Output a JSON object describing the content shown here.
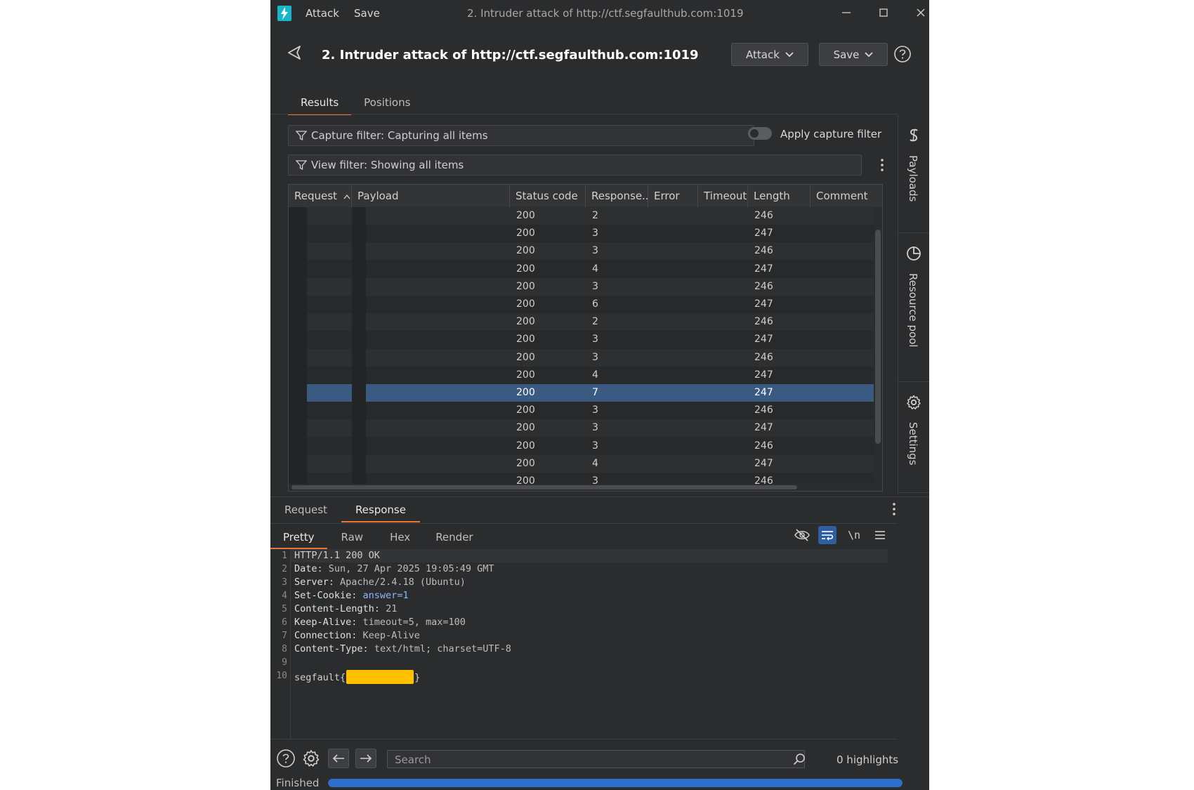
{
  "titlebar": {
    "menu": [
      "Attack",
      "Save"
    ],
    "title": "2. Intruder attack of http://ctf.segfaulthub.com:1019"
  },
  "header": {
    "title": "2. Intruder attack of http://ctf.segfaulthub.com:1019",
    "attack_label": "Attack",
    "save_label": "Save"
  },
  "tabs": [
    "Results",
    "Positions"
  ],
  "filters": {
    "capture": "Capture filter: Capturing all items",
    "view": "View filter: Showing all items",
    "apply_label": "Apply capture filter"
  },
  "table": {
    "columns": [
      "Request",
      "Payload",
      "Status code",
      "Response...",
      "Error",
      "Timeout",
      "Length",
      "Comment"
    ],
    "rows": [
      {
        "status": "200",
        "response": "2",
        "length": "246"
      },
      {
        "status": "200",
        "response": "3",
        "length": "247"
      },
      {
        "status": "200",
        "response": "3",
        "length": "246"
      },
      {
        "status": "200",
        "response": "4",
        "length": "247"
      },
      {
        "status": "200",
        "response": "3",
        "length": "246"
      },
      {
        "status": "200",
        "response": "6",
        "length": "247"
      },
      {
        "status": "200",
        "response": "2",
        "length": "246"
      },
      {
        "status": "200",
        "response": "3",
        "length": "247"
      },
      {
        "status": "200",
        "response": "3",
        "length": "246"
      },
      {
        "status": "200",
        "response": "4",
        "length": "247"
      },
      {
        "status": "200",
        "response": "7",
        "length": "247",
        "selected": true
      },
      {
        "status": "200",
        "response": "3",
        "length": "246"
      },
      {
        "status": "200",
        "response": "3",
        "length": "247"
      },
      {
        "status": "200",
        "response": "3",
        "length": "246"
      },
      {
        "status": "200",
        "response": "4",
        "length": "247"
      },
      {
        "status": "200",
        "response": "3",
        "length": "246"
      }
    ]
  },
  "side_panel": [
    "Payloads",
    "Resource pool",
    "Settings"
  ],
  "lower_tabs": [
    "Request",
    "Response"
  ],
  "sub_tabs": [
    "Pretty",
    "Raw",
    "Hex",
    "Render"
  ],
  "response": {
    "line_numbers": [
      "1",
      "2",
      "3",
      "4",
      "5",
      "6",
      "7",
      "8",
      "9",
      "10"
    ],
    "status_line": "HTTP/1.1 200 OK",
    "headers": [
      {
        "k": "Date",
        "v": "Sun, 27 Apr 2025 19:05:49 GMT"
      },
      {
        "k": "Server",
        "v": "Apache/2.4.18 (Ubuntu)"
      },
      {
        "k": "Set-Cookie",
        "v": "answer=1"
      },
      {
        "k": "Content-Length",
        "v": "21"
      },
      {
        "k": "Keep-Alive",
        "v": "timeout=5, max=100"
      },
      {
        "k": "Connection",
        "v": "Keep-Alive"
      },
      {
        "k": "Content-Type",
        "v": "text/html; charset=UTF-8"
      }
    ],
    "body_prefix": "segfault{",
    "body_suffix": "}"
  },
  "footer": {
    "search_placeholder": "Search",
    "highlights": "0 highlights",
    "status": "Finished",
    "progress": 1.0
  },
  "colors": {
    "accent": "#e8743b",
    "selection": "#3a5a82",
    "redaction": "#ffc000",
    "progress": "#2f6fcc"
  }
}
